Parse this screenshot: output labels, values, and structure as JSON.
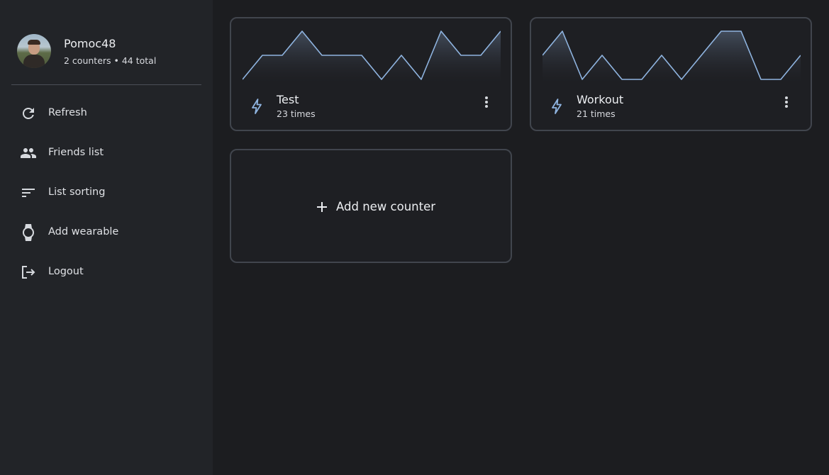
{
  "profile": {
    "name": "Pomoc48",
    "stats": "2 counters • 44 total"
  },
  "menu": [
    {
      "label": "Refresh",
      "icon": "refresh-icon"
    },
    {
      "label": "Friends list",
      "icon": "people-icon"
    },
    {
      "label": "List sorting",
      "icon": "sort-icon"
    },
    {
      "label": "Add wearable",
      "icon": "watch-icon"
    },
    {
      "label": "Logout",
      "icon": "logout-icon"
    }
  ],
  "counters": [
    {
      "name": "Test",
      "count_label": "23 times",
      "icon": "bolt-icon",
      "history": [
        0,
        1,
        1,
        2,
        1,
        1,
        1,
        0,
        1,
        0,
        2,
        1,
        1,
        2
      ]
    },
    {
      "name": "Workout",
      "count_label": "21 times",
      "icon": "bolt-icon",
      "history": [
        1,
        2,
        0,
        1,
        0,
        0,
        1,
        0,
        1,
        2,
        2,
        0,
        0,
        1
      ]
    }
  ],
  "add_card": {
    "label": "Add new counter",
    "icon": "plus-icon"
  },
  "colors": {
    "accent": "#8fb4e0",
    "background": "#1c1d20",
    "sidebar": "#222428",
    "card_border": "#41454d"
  }
}
